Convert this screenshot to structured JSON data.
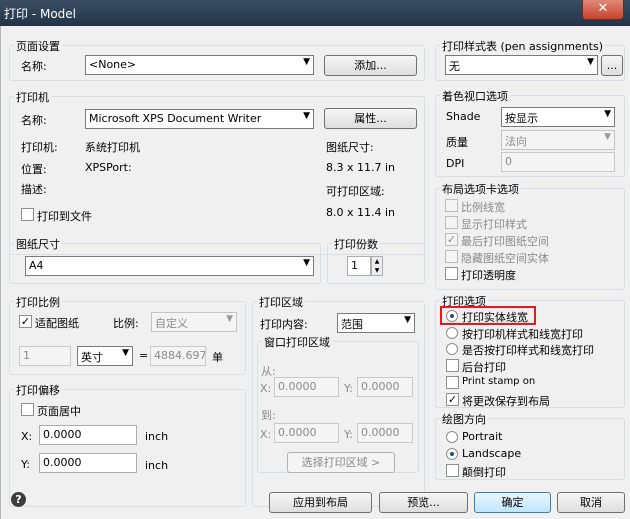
{
  "window": {
    "title": "打印 - Model",
    "close_glyph": "✕"
  },
  "page_setup": {
    "title": "页面设置",
    "name_label": "名称:",
    "name_value": "<None>",
    "add_button": "添加..."
  },
  "printer": {
    "title": "打印机",
    "name_label": "名称:",
    "name_value": "Microsoft XPS Document Writer",
    "properties_button": "属性...",
    "plotter_label": "打印机:",
    "plotter_value": "系统打印机",
    "where_label": "位置:",
    "where_value": "XPSPort:",
    "desc_label": "描述:",
    "paper_size_label": "图纸尺寸:",
    "paper_size_value": "8.3 x 11.7 in",
    "printable_label": "可打印区域:",
    "printable_value": "8.0 x 11.4 in",
    "print_to_file": "打印到文件"
  },
  "paper_size": {
    "title": "图纸尺寸",
    "value": "A4"
  },
  "copies": {
    "title": "打印份数",
    "value": "1"
  },
  "plot_scale": {
    "title": "打印比例",
    "fit_paper": "适配图纸",
    "scale_label": "比例:",
    "scale_value": "自定义",
    "num_value": "1",
    "unit_value": "英寸",
    "equals": "=",
    "units_value": "4884.6971",
    "unit_label": "单"
  },
  "plot_area": {
    "title": "打印区域",
    "what_label": "打印内容:",
    "what_value": "范围",
    "window_title": "窗口打印区域",
    "from_label": "从:",
    "to_label": "到:",
    "x_label": "X:",
    "y_label": "Y:",
    "from_x": "0.0000",
    "from_y": "0.0000",
    "to_x": "0.0000",
    "to_y": "0.0000",
    "select_button": "选择打印区域 >"
  },
  "plot_offset": {
    "title": "打印偏移",
    "center": "页面居中",
    "x_label": "X:",
    "x_value": "0.0000",
    "y_label": "Y:",
    "y_value": "0.0000",
    "x_unit": "inch",
    "y_unit": "inch"
  },
  "plot_style": {
    "title": "打印样式表 (pen assignments)",
    "value": "无",
    "edit_button": "..."
  },
  "shaded": {
    "title": "着色视口选项",
    "shade_label": "Shade",
    "shade_value": "按显示",
    "quality_label": "质量",
    "quality_value": "法向",
    "dpi_label": "DPI",
    "dpi_value": "0"
  },
  "layout_options": {
    "title": "布局选项卡选项",
    "scale_lineweights": "比例线宽",
    "show_styles": "显示打印样式",
    "paperspace_last": "最后打印图纸空间",
    "hide_objects": "隐藏图纸空间实体",
    "transparency": "打印透明度"
  },
  "print_options": {
    "title": "打印选项",
    "solid_lineweights": "打印实体线宽",
    "by_styles": "按打印机样式和线宽打印",
    "plot_with_styles": "是否按打印样式和线宽打印",
    "background": "后台打印",
    "stamp": "Print stamp on",
    "save_changes": "将更改保存到布局"
  },
  "orientation": {
    "title": "绘图方向",
    "portrait": "Portrait",
    "landscape": "Landscape",
    "upside_down": "颠倒打印"
  },
  "footer": {
    "help_glyph": "?",
    "apply": "应用到布局",
    "preview": "预览...",
    "ok": "确定",
    "cancel": "取消"
  }
}
